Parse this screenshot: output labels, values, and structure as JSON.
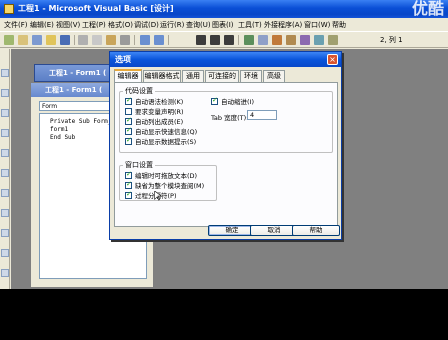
{
  "app": {
    "title": "工程1 - Microsoft Visual Basic [设计]",
    "watermark": "优酷"
  },
  "menu": [
    "文件(F)",
    "编辑(E)",
    "视图(V)",
    "工程(P)",
    "格式(O)",
    "调试(D)",
    "运行(R)",
    "查询(U)",
    "图表(I)",
    "工具(T)",
    "外接程序(A)",
    "窗口(W)",
    "帮助"
  ],
  "toolbar": {
    "coords": "2, 列 1"
  },
  "windows": {
    "project_title": "工程1 - Form1 (",
    "code_title": "工程1 - Form1 (",
    "object_combo": "Form",
    "code_lines": [
      "Private Sub Form_",
      "form1",
      "End Sub"
    ]
  },
  "dialog": {
    "title": "选项",
    "tabs": [
      "编辑器",
      "编辑器格式",
      "通用",
      "可连接的",
      "环境",
      "高级"
    ],
    "group_code": "代码设置",
    "code_options": [
      {
        "label": "自动语法检测(K)",
        "checked": true
      },
      {
        "label": "要求变量声明(R)",
        "checked": false
      },
      {
        "label": "自动列出成员(E)",
        "checked": true
      },
      {
        "label": "自动显示快速信息(Q)",
        "checked": true
      },
      {
        "label": "自动显示数据提示(S)",
        "checked": true
      }
    ],
    "auto_indent": {
      "label": "自动缩进(I)",
      "checked": true
    },
    "tab_width_label": "Tab 宽度(T):",
    "tab_width_value": "4",
    "group_window": "窗口设置",
    "window_options": [
      {
        "label": "编辑时可拖放文本(D)",
        "checked": true
      },
      {
        "label": "缺省为整个模块查阅(M)",
        "checked": true
      },
      {
        "label": "过程分隔符(P)",
        "checked": true
      }
    ],
    "buttons": {
      "ok": "确定",
      "cancel": "取消",
      "help": "帮助"
    }
  }
}
